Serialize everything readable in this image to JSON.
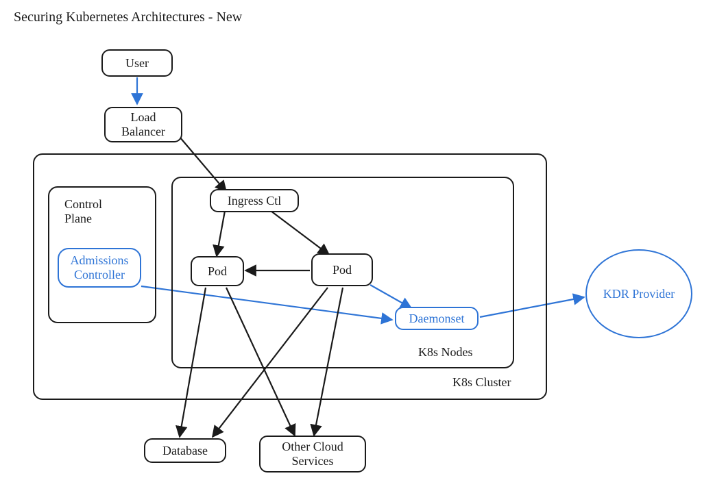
{
  "title": "Securing Kubernetes Architectures - New",
  "nodes": {
    "user": "User",
    "load_balancer": "Load\nBalancer",
    "ingress_ctl": "Ingress Ctl",
    "pod_left": "Pod",
    "pod_right": "Pod",
    "daemonset": "Daemonset",
    "admissions_controller": "Admissions\nController",
    "database": "Database",
    "other_cloud": "Other Cloud\nServices",
    "kdr_provider": "KDR Provider"
  },
  "containers": {
    "k8s_cluster": "K8s Cluster",
    "k8s_nodes": "K8s Nodes",
    "control_plane": "Control\nPlane"
  },
  "colors": {
    "black": "#1a1a1a",
    "blue": "#2e74d6"
  }
}
